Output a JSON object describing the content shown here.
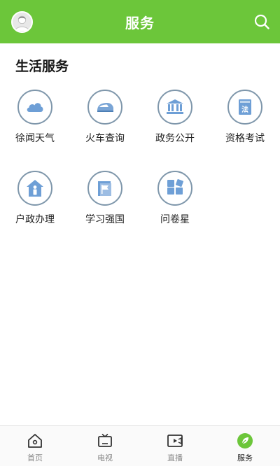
{
  "header": {
    "title": "服务",
    "avatar_icon": "user-avatar-icon",
    "search_icon": "search-icon"
  },
  "section": {
    "title": "生活服务"
  },
  "services": [
    {
      "label": "徐闻天气",
      "icon": "cloud-icon"
    },
    {
      "label": "火车查询",
      "icon": "train-icon"
    },
    {
      "label": "政务公开",
      "icon": "government-building-icon"
    },
    {
      "label": "资格考试",
      "icon": "law-book-icon"
    },
    {
      "label": "户政办理",
      "icon": "house-person-icon"
    },
    {
      "label": "学习强国",
      "icon": "flag-book-icon"
    },
    {
      "label": "问卷星",
      "icon": "survey-grid-icon"
    }
  ],
  "bottom_nav": {
    "items": [
      {
        "label": "首页",
        "icon": "home-icon"
      },
      {
        "label": "电视",
        "icon": "tv-icon"
      },
      {
        "label": "直播",
        "icon": "live-video-icon"
      },
      {
        "label": "服务",
        "icon": "leaf-icon",
        "active": true
      }
    ]
  },
  "colors": {
    "brand_green": "#6cc63a",
    "icon_blue": "#6e9fd6",
    "icon_border": "#7f97ab"
  }
}
